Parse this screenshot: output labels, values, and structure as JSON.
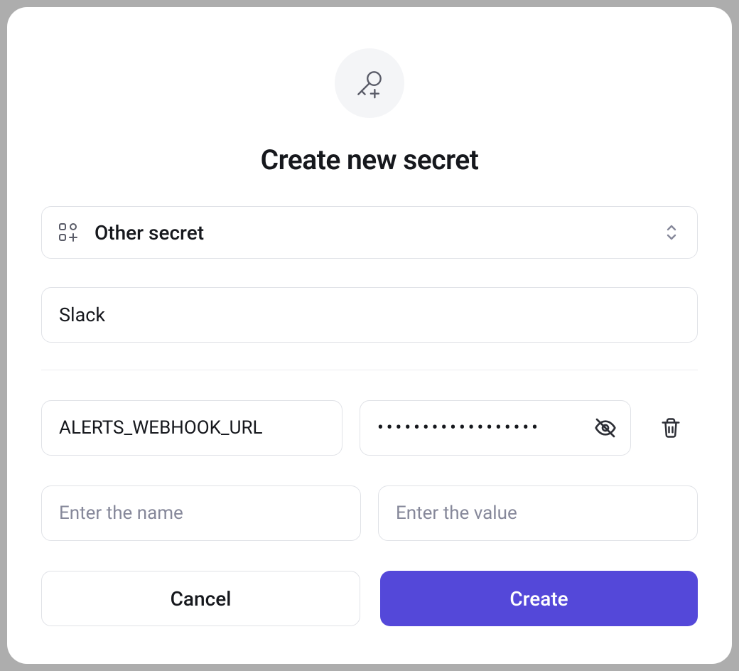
{
  "dialog": {
    "title": "Create new secret",
    "type_selector": {
      "selected": "Other secret"
    },
    "name_input": {
      "value": "Slack"
    },
    "entries": [
      {
        "key": "ALERTS_WEBHOOK_URL",
        "value": "●●●●●●●●●●●●●●●●●●",
        "masked": true,
        "deletable": true
      },
      {
        "key": "",
        "value": "",
        "key_placeholder": "Enter the name",
        "value_placeholder": "Enter the value",
        "masked": false,
        "deletable": false
      }
    ],
    "buttons": {
      "cancel": "Cancel",
      "create": "Create"
    }
  }
}
